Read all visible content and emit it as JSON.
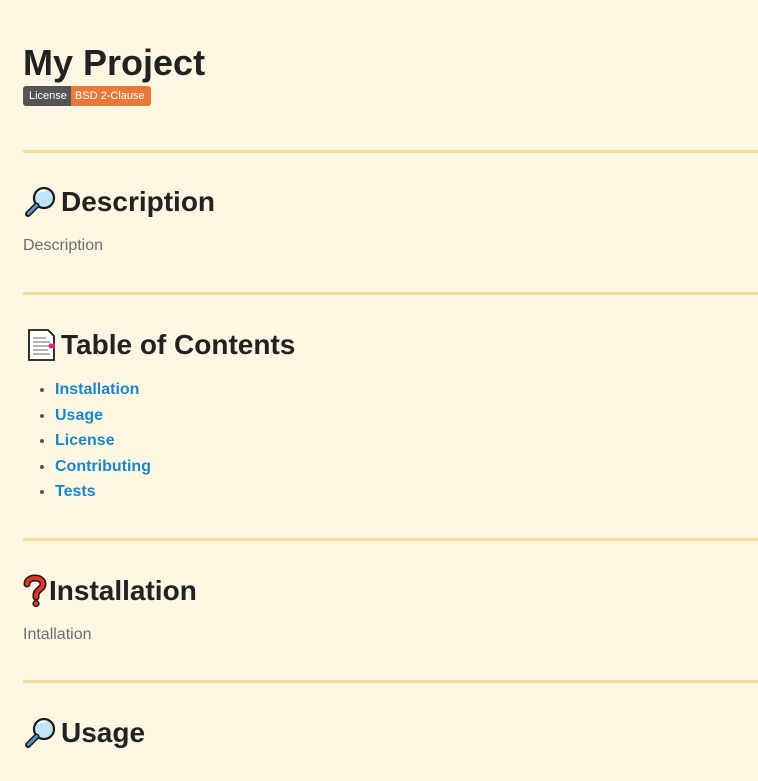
{
  "title": "My Project",
  "badge": {
    "left": "License",
    "right": "BSD 2-Clause"
  },
  "sections": {
    "description": {
      "heading": "Description",
      "icon": "magnifier-icon",
      "body": "Description"
    },
    "toc": {
      "heading": "Table of Contents",
      "icon": "document-icon",
      "items": [
        "Installation",
        "Usage",
        "License",
        "Contributing",
        "Tests"
      ]
    },
    "installation": {
      "heading": "Installation",
      "icon": "question-mark-icon",
      "body": "Intallation"
    },
    "usage": {
      "heading": "Usage",
      "icon": "magnifier-icon"
    }
  },
  "colors": {
    "background": "#fdf6e3",
    "rule": "#f6dc99",
    "link": "#1a86c8",
    "badge_right": "#e8793a"
  }
}
